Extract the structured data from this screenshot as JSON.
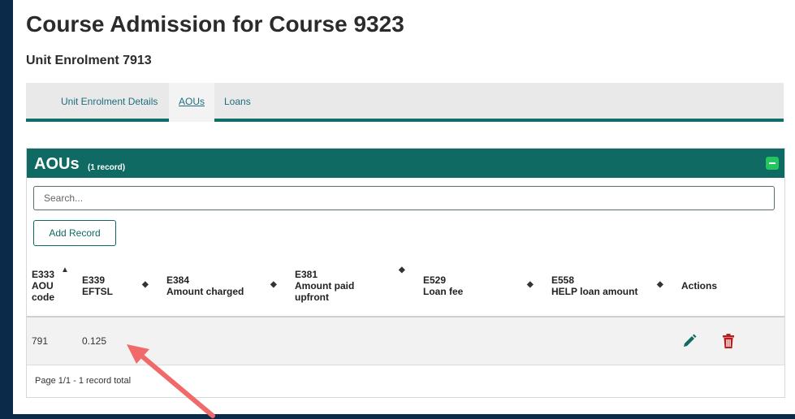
{
  "page_title": "Course Admission for Course 9323",
  "sub_title": "Unit Enrolment 7913",
  "tabs": [
    {
      "label": "Unit Enrolment Details",
      "active": false
    },
    {
      "label": "AOUs",
      "active": true
    },
    {
      "label": "Loans",
      "active": false
    }
  ],
  "panel": {
    "title": "AOUs",
    "count": "(1 record)",
    "search_placeholder": "Search...",
    "add_label": "Add Record"
  },
  "table": {
    "columns": [
      {
        "code": "E333",
        "label": "AOU code"
      },
      {
        "code": "E339",
        "label": "EFTSL"
      },
      {
        "code": "E384",
        "label": "Amount charged"
      },
      {
        "code": "E381",
        "label": "Amount paid upfront"
      },
      {
        "code": "E529",
        "label": "Loan fee"
      },
      {
        "code": "E558",
        "label": "HELP loan amount"
      },
      {
        "code": "",
        "label": "Actions"
      }
    ],
    "rows": [
      {
        "aou_code": "791",
        "eftsl": "0.125",
        "amount_charged": "",
        "amount_paid_upfront": "",
        "loan_fee": "",
        "help_loan_amount": ""
      }
    ]
  },
  "footer": "Page 1/1 - 1 record total",
  "colors": {
    "accent": "#0e6a62",
    "delete": "#b91c1c",
    "edit": "#0e6a62",
    "arrow": "#f06a6a"
  },
  "icons": [
    "collapse-icon",
    "pencil-icon",
    "trash-icon",
    "sort-icon"
  ]
}
